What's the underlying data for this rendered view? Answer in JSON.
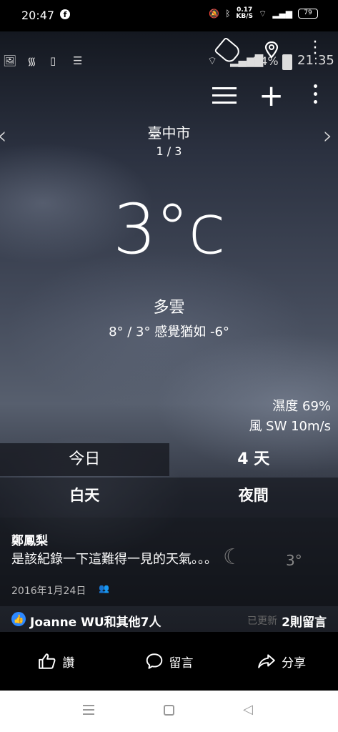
{
  "status_bar": {
    "time": "20:47",
    "speed_value": "0.17",
    "speed_unit": "KB/S",
    "battery": "79"
  },
  "inner_status": {
    "battery_pct": "74%",
    "clock": "21:35"
  },
  "weather": {
    "city": "臺中市",
    "page": "1 / 3",
    "temperature": "3°c",
    "condition": "多雲",
    "hi_lo_feels": "8° / 3° 感覺猶如 -6°",
    "humidity": "濕度 69%",
    "wind": "風 SW 10m/s",
    "tabs": [
      "今日",
      "4 天"
    ],
    "subtabs": [
      "白天",
      "夜間"
    ]
  },
  "post": {
    "author": "鄭鳳梨",
    "message": "是該紀錄一下這難得一見的天氣。。。",
    "date": "2016年1月24日",
    "hidden_temp": "3°",
    "reactions": "Joanne WU和其他7人",
    "updated": "已更新",
    "comments": "2則留言"
  },
  "actions": {
    "like": "讚",
    "comment": "留言",
    "share": "分享"
  }
}
